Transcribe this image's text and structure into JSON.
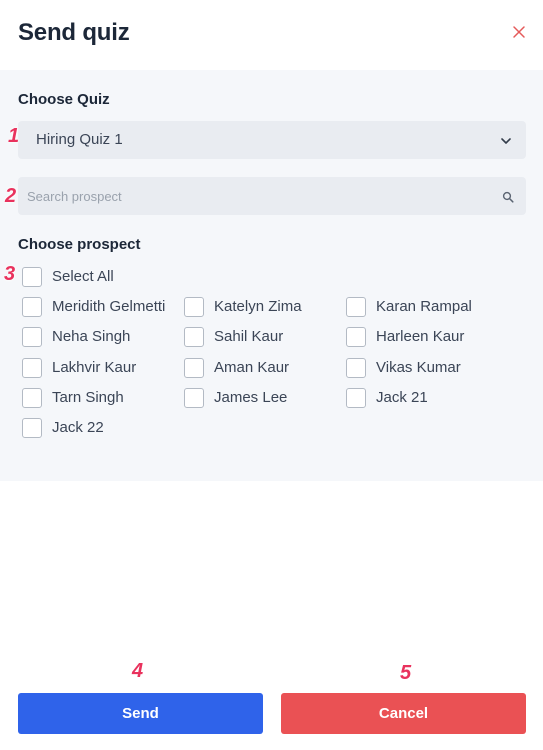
{
  "dialog": {
    "title": "Send quiz",
    "close_icon": "close-icon"
  },
  "quiz": {
    "label": "Choose Quiz",
    "selected": "Hiring Quiz 1"
  },
  "search": {
    "placeholder": "Search prospect",
    "icon": "search-icon"
  },
  "prospects": {
    "label": "Choose prospect",
    "select_all": "Select All",
    "items": [
      {
        "name": "Meridith Gelmetti",
        "checked": false
      },
      {
        "name": "Katelyn Zima",
        "checked": false
      },
      {
        "name": "Karan Rampal",
        "checked": false
      },
      {
        "name": "Neha Singh",
        "checked": false
      },
      {
        "name": "Sahil Kaur",
        "checked": false
      },
      {
        "name": "Harleen Kaur",
        "checked": false
      },
      {
        "name": "Lakhvir Kaur",
        "checked": false
      },
      {
        "name": "Aman Kaur",
        "checked": false
      },
      {
        "name": "Vikas Kumar",
        "checked": false
      },
      {
        "name": "Tarn Singh",
        "checked": false
      },
      {
        "name": "James Lee",
        "checked": false
      },
      {
        "name": "Jack 21",
        "checked": false
      },
      {
        "name": "Jack 22",
        "checked": false
      }
    ]
  },
  "actions": {
    "send_label": "Send",
    "cancel_label": "Cancel"
  },
  "annotations": [
    "1",
    "2",
    "3",
    "4",
    "5"
  ],
  "colors": {
    "send": "#2f63ea",
    "cancel": "#ea5154",
    "annotation": "#e9325d",
    "close": "#e55a5a"
  }
}
